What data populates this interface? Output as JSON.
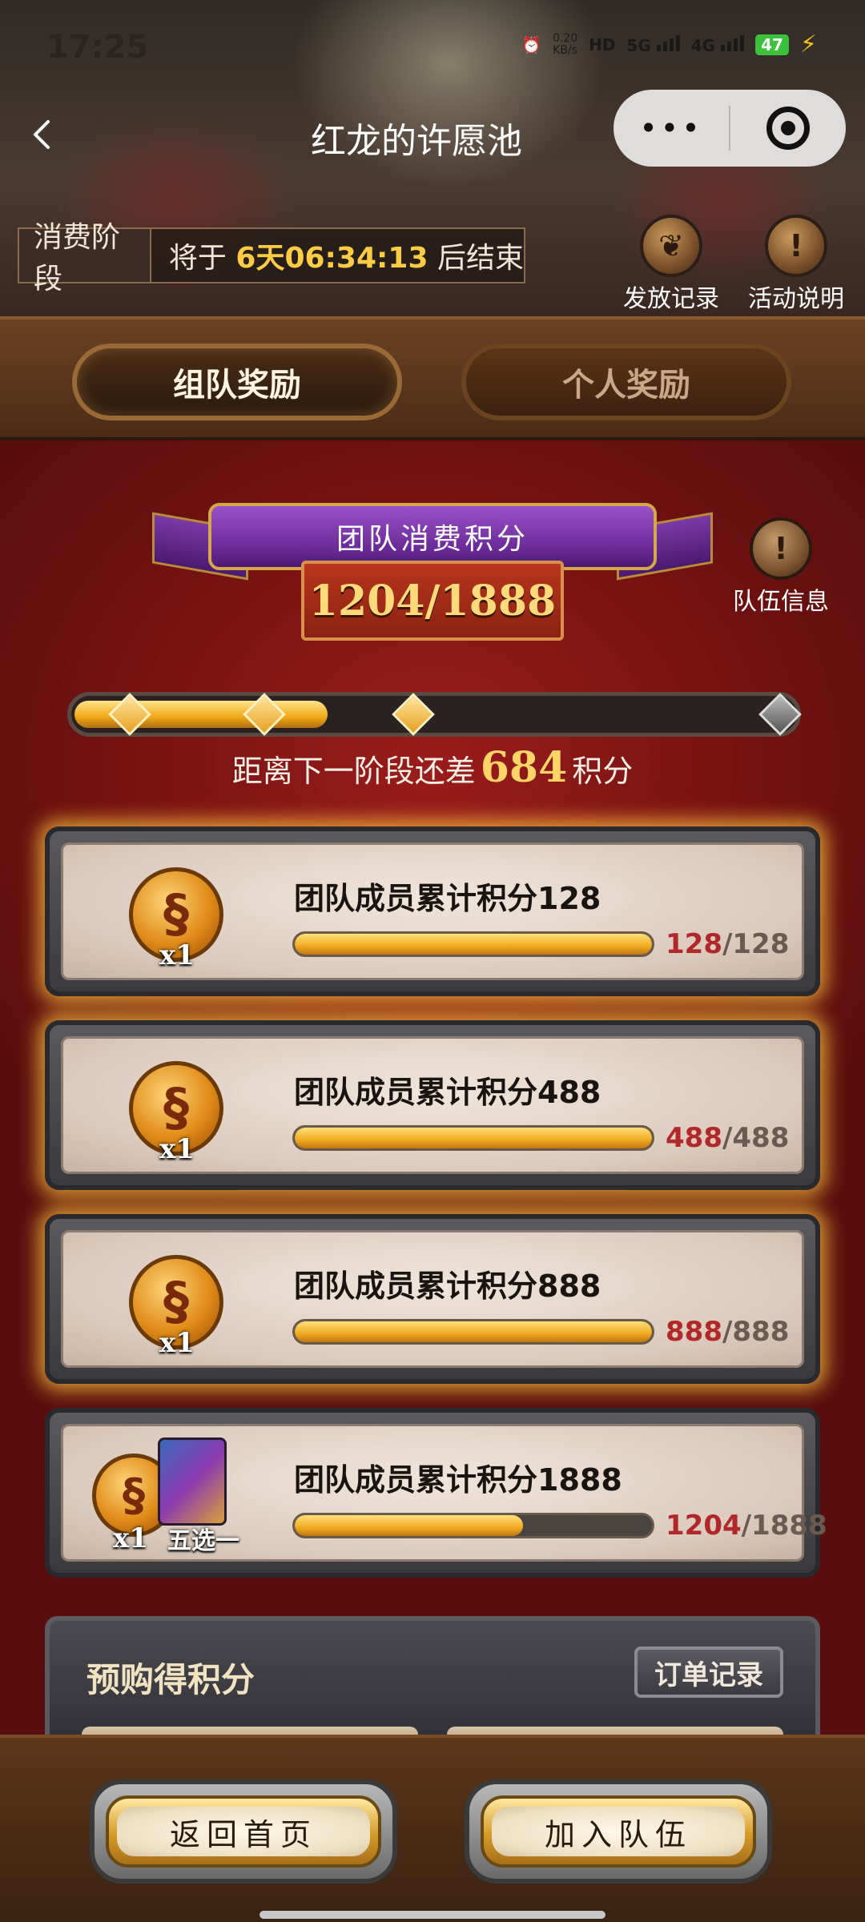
{
  "status_bar": {
    "time": "17:25",
    "speed_value": "0.20",
    "speed_unit": "KB/s",
    "hd": "HD",
    "net1": "5G",
    "net2": "4G",
    "battery": "47"
  },
  "nav": {
    "title": "红龙的许愿池",
    "more": "•••"
  },
  "stage": {
    "tag": "消费阶段",
    "prefix": "将于",
    "countdown": "6天06:34:13",
    "suffix": "后结束"
  },
  "header_buttons": {
    "issue_records": "发放记录",
    "activity_info": "活动说明"
  },
  "tabs": [
    {
      "label": "组队奖励",
      "active": true
    },
    {
      "label": "个人奖励",
      "active": false
    }
  ],
  "team_score": {
    "banner": "团队消费积分",
    "current": 1204,
    "target": 1888,
    "display": "1204/1888",
    "team_info": "队伍信息",
    "progress_fraction": 0.35
  },
  "next_stage": {
    "prefix": "距离下一阶段还差",
    "value": "684",
    "suffix": "积分"
  },
  "rewards": [
    {
      "title": "团队成员累计积分128",
      "qty": "x1",
      "current": "128",
      "total": "/128",
      "fraction": 1.0
    },
    {
      "title": "团队成员累计积分488",
      "qty": "x1",
      "current": "488",
      "total": "/488",
      "fraction": 1.0
    },
    {
      "title": "团队成员累计积分888",
      "qty": "x1",
      "current": "888",
      "total": "/888",
      "fraction": 1.0
    },
    {
      "title": "团队成员累计积分1888",
      "qty": "x1",
      "current": "1204",
      "total": "/1888",
      "fraction": 0.64,
      "extra": "五选一"
    }
  ],
  "prepurchase": {
    "title": "预购得积分",
    "order_button": "订单记录"
  },
  "bottom": {
    "home": "返回首页",
    "join": "加入队伍"
  },
  "colors": {
    "accent_gold": "#f0a818",
    "bg_red": "#7a1212",
    "tab_active": "#9a6a36"
  }
}
